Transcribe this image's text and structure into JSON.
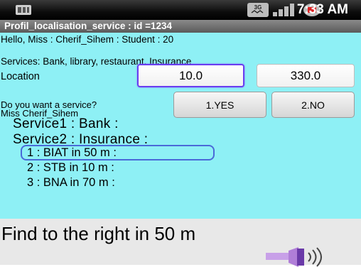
{
  "status_bar": {
    "clock": "7:33 AM",
    "network_label": "3G",
    "icons": [
      "sim-icon",
      "network-3g-icon",
      "signal-bars-icon",
      "battery-icon"
    ]
  },
  "title_bar": {
    "title": "Profil_localisation_service : id =1234"
  },
  "content": {
    "greeting": "Hello,  Miss  : Cherif_Sihem   : Student   : 20",
    "services_line": "Services: Bank, library, restaurant, Insurance",
    "location_label": "Location",
    "location_x_value": "10.0",
    "location_y_value": "330.0",
    "question_line1": "Do you want a service?",
    "question_line2": "Miss Cherif_Sihem",
    "yes_button": "1.YES",
    "no_button": "2.NO",
    "service1": "Service1  : Bank  :",
    "service2": "Service2  : Insurance  :",
    "results": [
      "1  :  BIAT in 50 m  :",
      "2  :  STB in 10 m  :",
      "3  :  BNA in 70 m  :"
    ]
  },
  "bottom": {
    "message": "Find to the right in 50 m",
    "speaker_icon": "speaker-sound-icon"
  },
  "colors": {
    "content_background": "#8ef0f5",
    "selection_border": "#4a6ad8",
    "focus_border": "#6a3df0"
  }
}
